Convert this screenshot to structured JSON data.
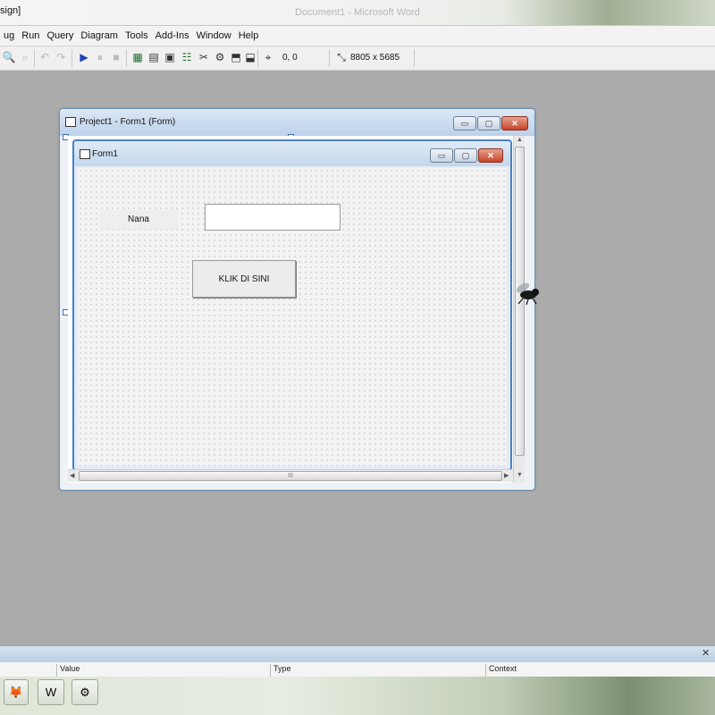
{
  "titlebar": {
    "left_text": "sign]",
    "center_text": "Document1 - Microsoft Word"
  },
  "menu": {
    "items": [
      "ug",
      "Run",
      "Query",
      "Diagram",
      "Tools",
      "Add-Ins",
      "Window",
      "Help"
    ]
  },
  "toolbar": {
    "position_readout": "0, 0",
    "size_readout": "8805 x 5685"
  },
  "outer_window": {
    "title": "Project1 - Form1 (Form)",
    "buttons": {
      "minimize": "▭",
      "maximize": "▢",
      "close": "✕"
    }
  },
  "form": {
    "title": "Form1",
    "label_text": "Nana",
    "textbox_value": "",
    "button_label": "KLIK DI SINI",
    "hscroll_grip": "III"
  },
  "properties_pane": {
    "columns": [
      "Value",
      "Type",
      "Context"
    ],
    "close_symbol": "✕"
  },
  "colors": {
    "workspace": "#ababab",
    "form_border": "#4a7fc6",
    "close_button": "#c8452b"
  }
}
